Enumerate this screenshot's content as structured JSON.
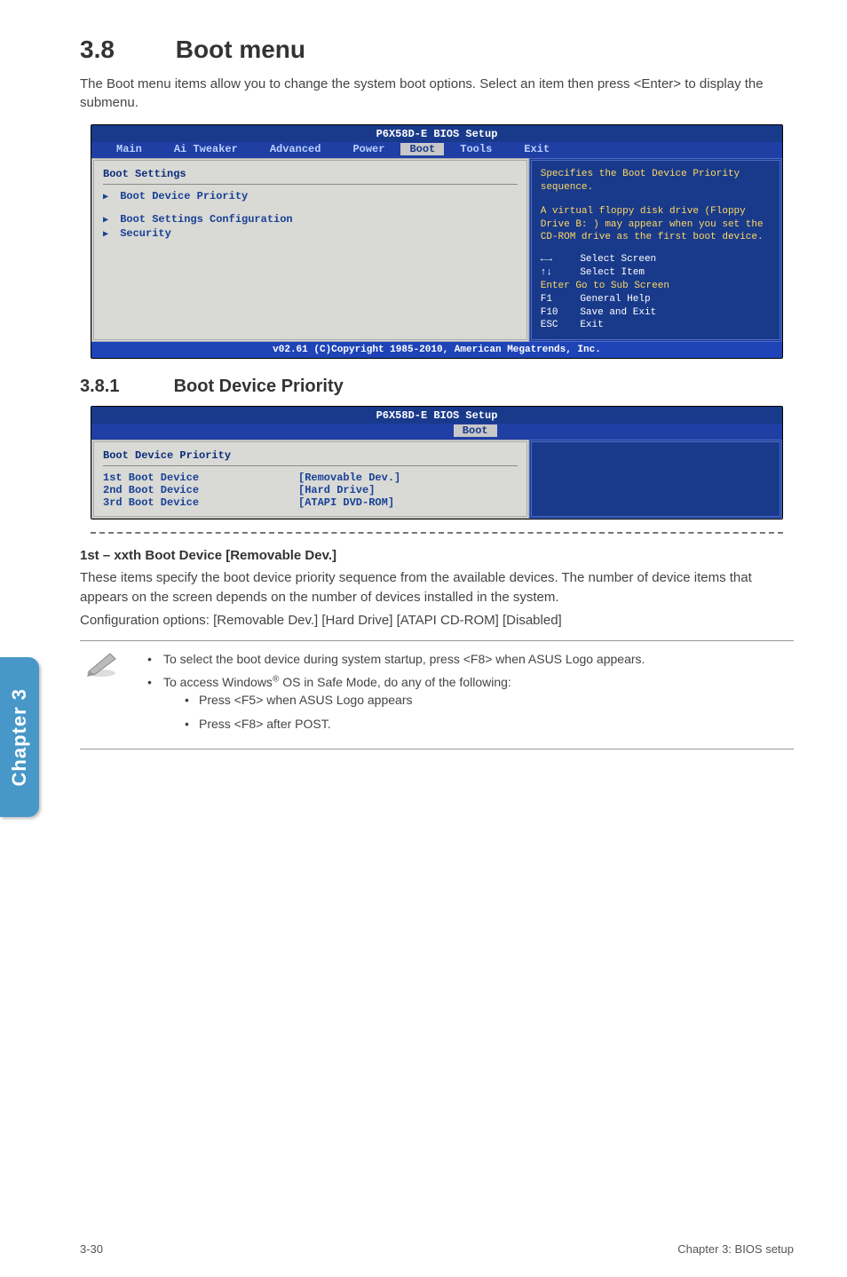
{
  "section": {
    "number": "3.8",
    "title": "Boot menu",
    "lead": "The Boot menu items allow you to change the system boot options. Select an item then press <Enter> to display the submenu."
  },
  "bios1": {
    "title": "P6X58D-E BIOS Setup",
    "tabs": [
      "Main",
      "Ai Tweaker",
      "Advanced",
      "Power",
      "Boot",
      "Tools",
      "Exit"
    ],
    "selected_tab": "Boot",
    "heading": "Boot Settings",
    "rows": [
      "Boot Device Priority",
      "Boot Settings Configuration",
      "Security"
    ],
    "help_top": "Specifies the Boot Device Priority sequence.",
    "help_mid": "A virtual floppy disk drive (Floppy Drive B: ) may appear when you set the CD-ROM drive as the first boot device.",
    "keys": {
      "lr": "←→",
      "lr_label": "Select Screen",
      "ud": "↑↓",
      "ud_label": "Select Item",
      "enter_label": "Enter Go to Sub Screen",
      "f1": "F1",
      "f1_label": "General Help",
      "f10": "F10",
      "f10_label": "Save and Exit",
      "esc": "ESC",
      "esc_label": "Exit"
    },
    "footer": "v02.61 (C)Copyright 1985-2010, American Megatrends, Inc."
  },
  "subsection": {
    "number": "3.8.1",
    "title": "Boot Device Priority"
  },
  "bios2": {
    "title": "P6X58D-E BIOS Setup",
    "selected_tab": "Boot",
    "heading": "Boot Device Priority",
    "items": [
      {
        "k": "1st Boot Device",
        "v": "[Removable Dev.]"
      },
      {
        "k": "2nd Boot Device",
        "v": "[Hard Drive]"
      },
      {
        "k": "3rd Boot Device",
        "v": "[ATAPI DVD-ROM]"
      }
    ]
  },
  "h3": "1st – xxth Boot Device [Removable Dev.]",
  "para": "These items specify the boot device priority sequence from the available devices. The number of device items that appears on the screen depends on the number of devices installed in the system.",
  "opts_label": "Configuration options: ",
  "opts": "[Removable Dev.] [Hard Drive] [ATAPI CD-ROM] [Disabled]",
  "note": {
    "b1": "To select the boot device during system startup, press <F8> when ASUS Logo appears.",
    "b2a": "To access Windows",
    "b2b": " OS in Safe Mode, do any of the following:",
    "s1": "Press <F5> when ASUS Logo appears",
    "s2": "Press <F8> after POST."
  },
  "sidetab": "Chapter 3",
  "footer_left": "3-30",
  "footer_right": "Chapter 3: BIOS setup"
}
